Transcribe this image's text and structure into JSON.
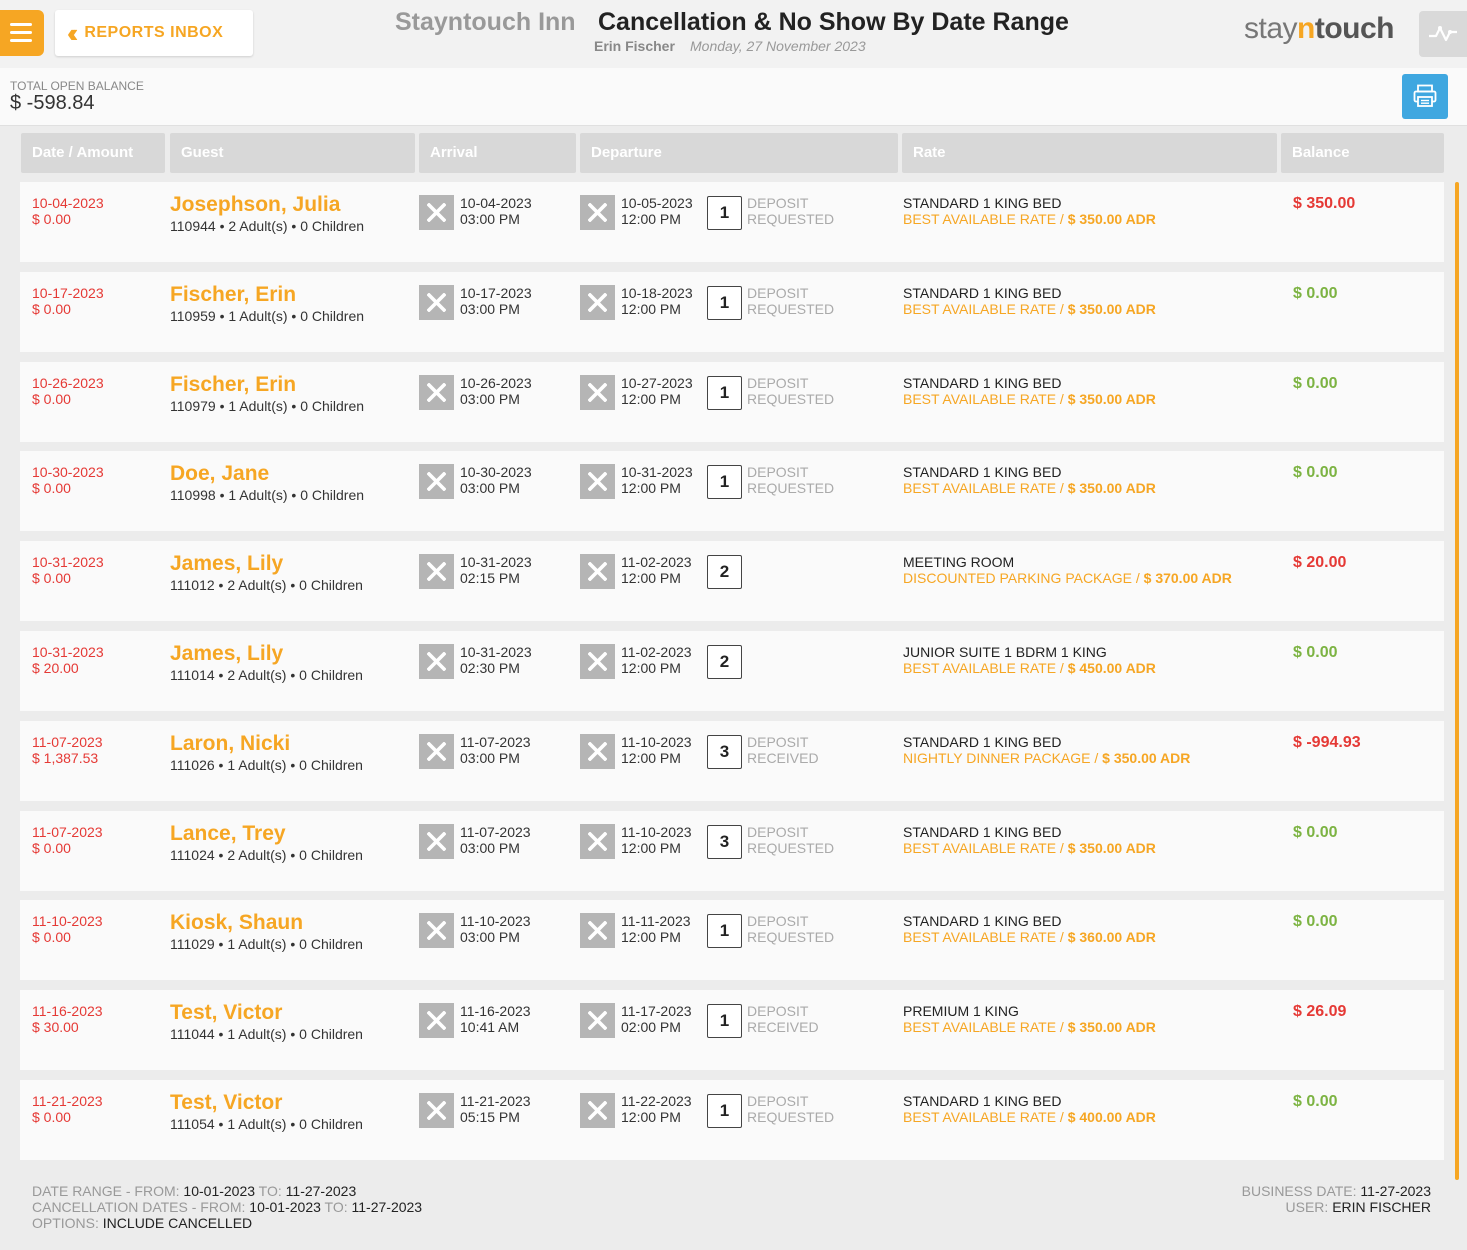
{
  "header": {
    "inbox_label": "REPORTS INBOX",
    "hotel_name": "Stayntouch Inn",
    "report_title": "Cancellation & No Show By Date Range",
    "user": "Erin Fischer",
    "date": "Monday, 27 November 2023",
    "logo": {
      "pre": "stay",
      "n": "n",
      "post": "touch"
    }
  },
  "summary": {
    "open_balance_label": "TOTAL OPEN BALANCE",
    "open_balance_value": "$ -598.84"
  },
  "columns": [
    "Date / Amount",
    "Guest",
    "Arrival",
    "Departure",
    "Rate",
    "Balance"
  ],
  "rows": [
    {
      "date": "10-04-2023",
      "amount": "$ 0.00",
      "name": "Josephson, Julia",
      "res": "110944",
      "adults": "2 Adult(s)",
      "children": "0 Children",
      "arr_date": "10-04-2023",
      "arr_time": "03:00 PM",
      "dep_date": "10-05-2023",
      "dep_time": "12:00 PM",
      "nights": "1",
      "dep1": "DEPOSIT",
      "dep2": "REQUESTED",
      "room": "STANDARD 1 KING BED",
      "rate": "BEST AVAILABLE RATE / ",
      "adr": "$ 350.00 ADR",
      "balance": "$ 350.00",
      "balance_color": "#e53935"
    },
    {
      "date": "10-17-2023",
      "amount": "$ 0.00",
      "name": "Fischer, Erin",
      "res": "110959",
      "adults": "1 Adult(s)",
      "children": "0 Children",
      "arr_date": "10-17-2023",
      "arr_time": "03:00 PM",
      "dep_date": "10-18-2023",
      "dep_time": "12:00 PM",
      "nights": "1",
      "dep1": "DEPOSIT",
      "dep2": "REQUESTED",
      "room": "STANDARD 1 KING BED",
      "rate": "BEST AVAILABLE RATE / ",
      "adr": "$ 350.00 ADR",
      "balance": "$ 0.00",
      "balance_color": "#7cb342"
    },
    {
      "date": "10-26-2023",
      "amount": "$ 0.00",
      "name": "Fischer, Erin",
      "res": "110979",
      "adults": "1 Adult(s)",
      "children": "0 Children",
      "arr_date": "10-26-2023",
      "arr_time": "03:00 PM",
      "dep_date": "10-27-2023",
      "dep_time": "12:00 PM",
      "nights": "1",
      "dep1": "DEPOSIT",
      "dep2": "REQUESTED",
      "room": "STANDARD 1 KING BED",
      "rate": "BEST AVAILABLE RATE / ",
      "adr": "$ 350.00 ADR",
      "balance": "$ 0.00",
      "balance_color": "#7cb342"
    },
    {
      "date": "10-30-2023",
      "amount": "$ 0.00",
      "name": "Doe, Jane",
      "res": "110998",
      "adults": "1 Adult(s)",
      "children": "0 Children",
      "arr_date": "10-30-2023",
      "arr_time": "03:00 PM",
      "dep_date": "10-31-2023",
      "dep_time": "12:00 PM",
      "nights": "1",
      "dep1": "DEPOSIT",
      "dep2": "REQUESTED",
      "room": "STANDARD 1 KING BED",
      "rate": "BEST AVAILABLE RATE / ",
      "adr": "$ 350.00 ADR",
      "balance": "$ 0.00",
      "balance_color": "#7cb342"
    },
    {
      "date": "10-31-2023",
      "amount": "$ 0.00",
      "name": "James, Lily",
      "res": "111012",
      "adults": "2 Adult(s)",
      "children": "0 Children",
      "arr_date": "10-31-2023",
      "arr_time": "02:15 PM",
      "dep_date": "11-02-2023",
      "dep_time": "12:00 PM",
      "nights": "2",
      "dep1": "",
      "dep2": "",
      "room": "MEETING ROOM",
      "rate": "DISCOUNTED PARKING PACKAGE / ",
      "adr": "$ 370.00 ADR",
      "balance": "$ 20.00",
      "balance_color": "#e53935"
    },
    {
      "date": "10-31-2023",
      "amount": "$ 20.00",
      "name": "James, Lily",
      "res": "111014",
      "adults": "2 Adult(s)",
      "children": "0 Children",
      "arr_date": "10-31-2023",
      "arr_time": "02:30 PM",
      "dep_date": "11-02-2023",
      "dep_time": "12:00 PM",
      "nights": "2",
      "dep1": "",
      "dep2": "",
      "room": "JUNIOR SUITE 1 BDRM 1 KING",
      "rate": "BEST AVAILABLE RATE / ",
      "adr": "$ 450.00 ADR",
      "balance": "$ 0.00",
      "balance_color": "#7cb342"
    },
    {
      "date": "11-07-2023",
      "amount": "$ 1,387.53",
      "name": "Laron, Nicki",
      "res": "111026",
      "adults": "1 Adult(s)",
      "children": "0 Children",
      "arr_date": "11-07-2023",
      "arr_time": "03:00 PM",
      "dep_date": "11-10-2023",
      "dep_time": "12:00 PM",
      "nights": "3",
      "dep1": "DEPOSIT",
      "dep2": "RECEIVED",
      "room": "STANDARD 1 KING BED",
      "rate": "NIGHTLY DINNER PACKAGE / ",
      "adr": "$ 350.00 ADR",
      "balance": "$ -994.93",
      "balance_color": "#e53935"
    },
    {
      "date": "11-07-2023",
      "amount": "$ 0.00",
      "name": "Lance, Trey",
      "res": "111024",
      "adults": "2 Adult(s)",
      "children": "0 Children",
      "arr_date": "11-07-2023",
      "arr_time": "03:00 PM",
      "dep_date": "11-10-2023",
      "dep_time": "12:00 PM",
      "nights": "3",
      "dep1": "DEPOSIT",
      "dep2": "REQUESTED",
      "room": "STANDARD 1 KING BED",
      "rate": "BEST AVAILABLE RATE / ",
      "adr": "$ 350.00 ADR",
      "balance": "$ 0.00",
      "balance_color": "#7cb342"
    },
    {
      "date": "11-10-2023",
      "amount": "$ 0.00",
      "name": "Kiosk, Shaun",
      "res": "111029",
      "adults": "1 Adult(s)",
      "children": "0 Children",
      "arr_date": "11-10-2023",
      "arr_time": "03:00 PM",
      "dep_date": "11-11-2023",
      "dep_time": "12:00 PM",
      "nights": "1",
      "dep1": "DEPOSIT",
      "dep2": "REQUESTED",
      "room": "STANDARD 1 KING BED",
      "rate": "BEST AVAILABLE RATE / ",
      "adr": "$ 360.00 ADR",
      "balance": "$ 0.00",
      "balance_color": "#7cb342"
    },
    {
      "date": "11-16-2023",
      "amount": "$ 30.00",
      "name": "Test, Victor",
      "res": "111044",
      "adults": "1 Adult(s)",
      "children": "0 Children",
      "arr_date": "11-16-2023",
      "arr_time": "10:41 AM",
      "dep_date": "11-17-2023",
      "dep_time": "02:00 PM",
      "nights": "1",
      "dep1": "DEPOSIT",
      "dep2": "RECEIVED",
      "room": "PREMIUM 1 KING",
      "rate": "BEST AVAILABLE RATE / ",
      "adr": "$ 350.00 ADR",
      "balance": "$ 26.09",
      "balance_color": "#e53935"
    },
    {
      "date": "11-21-2023",
      "amount": "$ 0.00",
      "name": "Test, Victor",
      "res": "111054",
      "adults": "1 Adult(s)",
      "children": "0 Children",
      "arr_date": "11-21-2023",
      "arr_time": "05:15 PM",
      "dep_date": "11-22-2023",
      "dep_time": "12:00 PM",
      "nights": "1",
      "dep1": "DEPOSIT",
      "dep2": "REQUESTED",
      "room": "STANDARD 1 KING BED",
      "rate": "BEST AVAILABLE RATE / ",
      "adr": "$ 400.00 ADR",
      "balance": "$ 0.00",
      "balance_color": "#7cb342"
    }
  ],
  "footer": {
    "range_label": "DATE RANGE - FROM: ",
    "range_from": "10-01-2023",
    "to_label": " TO: ",
    "range_to": "11-27-2023",
    "cancel_label": "CANCELLATION DATES - FROM: ",
    "cancel_from": "10-01-2023",
    "cancel_to": "11-27-2023",
    "options_label": "OPTIONS: ",
    "options_value": "INCLUDE CANCELLED",
    "business_date_label": "BUSINESS DATE: ",
    "business_date": "11-27-2023",
    "user_label": "USER: ",
    "user_value": "ERIN FISCHER"
  },
  "colors": {
    "accent": "#f6a623",
    "red": "#e53935",
    "green": "#7cb342",
    "print": "#3fa7e0"
  },
  "icons": [
    "menu-icon",
    "double-chevron-left-icon",
    "activity-icon",
    "printer-icon",
    "close-x-icon"
  ]
}
